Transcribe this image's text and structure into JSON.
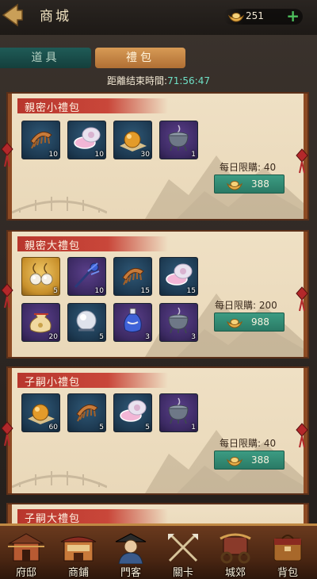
{
  "header": {
    "title": "商城",
    "currency_amount": "251",
    "add_label": "+"
  },
  "tabs": [
    {
      "label": "道具",
      "active": false
    },
    {
      "label": "禮包",
      "active": true
    }
  ],
  "timer": {
    "label": "距離结束時間:",
    "value": "71:56:47"
  },
  "packs": [
    {
      "name": "親密小禮包",
      "limit_label": "每日限購: 40",
      "price": "388",
      "items": [
        {
          "icon": "comb-icon",
          "qty": "10",
          "rarity": "blue"
        },
        {
          "icon": "powder-box-icon",
          "qty": "10",
          "rarity": "blue"
        },
        {
          "icon": "golden-orb-icon",
          "qty": "30",
          "rarity": "blue"
        },
        {
          "icon": "incense-burner-icon",
          "qty": "1",
          "rarity": "purple"
        }
      ]
    },
    {
      "name": "親密大禮包",
      "limit_label": "每日限購: 200",
      "price": "988",
      "items": [
        {
          "icon": "pearl-earrings-icon",
          "qty": "5",
          "rarity": "gold"
        },
        {
          "icon": "hairpin-icon",
          "qty": "10",
          "rarity": "purple"
        },
        {
          "icon": "comb-icon",
          "qty": "15",
          "rarity": "blue"
        },
        {
          "icon": "powder-box-icon",
          "qty": "15",
          "rarity": "blue"
        },
        {
          "icon": "pouch-icon",
          "qty": "20",
          "rarity": "purple"
        },
        {
          "icon": "pearl-icon",
          "qty": "5",
          "rarity": "blue"
        },
        {
          "icon": "vase-icon",
          "qty": "3",
          "rarity": "purple"
        },
        {
          "icon": "incense-burner-icon",
          "qty": "3",
          "rarity": "purple"
        }
      ]
    },
    {
      "name": "子嗣小禮包",
      "limit_label": "每日限購: 40",
      "price": "388",
      "items": [
        {
          "icon": "golden-orb-icon",
          "qty": "60",
          "rarity": "blue"
        },
        {
          "icon": "comb-icon",
          "qty": "5",
          "rarity": "blue"
        },
        {
          "icon": "powder-box-icon",
          "qty": "5",
          "rarity": "blue"
        },
        {
          "icon": "incense-burner-icon",
          "qty": "1",
          "rarity": "purple"
        }
      ]
    },
    {
      "name": "子嗣大禮包",
      "partial": true
    }
  ],
  "nav": [
    {
      "label": "府邸",
      "icon": "mansion-icon"
    },
    {
      "label": "商鋪",
      "icon": "shop-icon"
    },
    {
      "label": "門客",
      "icon": "retainer-icon"
    },
    {
      "label": "關卡",
      "icon": "battle-icon"
    },
    {
      "label": "城郊",
      "icon": "suburbs-icon"
    },
    {
      "label": "背包",
      "icon": "backpack-icon"
    }
  ],
  "colors": {
    "accent_teal": "#3c9c83",
    "timer_cyan": "#6fe0c6",
    "ribbon_red": "#b8362d",
    "add_green": "#4ec05d"
  }
}
